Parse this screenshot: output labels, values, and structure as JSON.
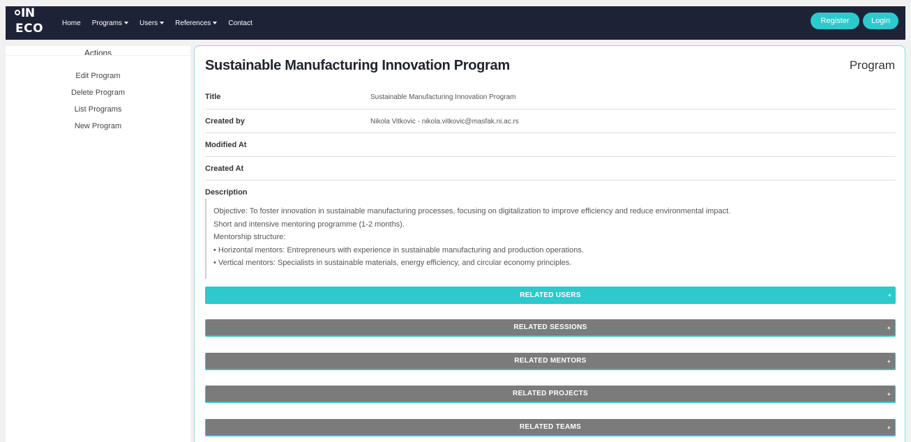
{
  "navbar": {
    "logo_line1": "IN",
    "logo_line2": "ECO",
    "items": [
      {
        "label": "Home",
        "dropdown": false
      },
      {
        "label": "Programs",
        "dropdown": true
      },
      {
        "label": "Users",
        "dropdown": true
      },
      {
        "label": "References",
        "dropdown": true
      },
      {
        "label": "Contact",
        "dropdown": false
      }
    ],
    "register_label": "Register",
    "login_label": "Login"
  },
  "sidebar": {
    "title": "Actions",
    "items": [
      {
        "label": "Edit Program"
      },
      {
        "label": "Delete Program"
      },
      {
        "label": "List Programs"
      },
      {
        "label": "New Program"
      }
    ]
  },
  "main": {
    "title": "Sustainable Manufacturing Innovation Program",
    "entity_type": "Program",
    "fields": [
      {
        "label": "Title",
        "value": "Sustainable Manufacturing Innovation Program"
      },
      {
        "label": "Created by",
        "value": "Nikola Vitkovic - nikola.vitkovic@masfak.ni.ac.rs"
      },
      {
        "label": "Modified At",
        "value": ""
      },
      {
        "label": "Created At",
        "value": ""
      }
    ],
    "description_label": "Description",
    "description_lines": [
      "Objective: To foster innovation in sustainable manufacturing processes, focusing on digitalization to improve efficiency and reduce environmental impact.",
      "Short and intensive mentoring programme (1-2 months).",
      "Mentorship structure:",
      "• Horizontal mentors: Entrepreneurs with experience in sustainable manufacturing and production operations.",
      "• Vertical mentors: Specialists in sustainable materials, energy efficiency, and circular economy principles."
    ],
    "accordions": [
      {
        "label": "RELATED USERS",
        "active": true,
        "icon": "+"
      },
      {
        "label": "RELATED SESSIONS",
        "active": false,
        "icon": "+"
      },
      {
        "label": "RELATED MENTORS",
        "active": false,
        "icon": "+"
      },
      {
        "label": "RELATED PROJECTS",
        "active": false,
        "icon": "+"
      },
      {
        "label": "RELATED TEAMS",
        "active": false,
        "icon": "+"
      }
    ]
  },
  "colors": {
    "navbar_bg": "#1d2337",
    "accent": "#2dc9cc",
    "accordion_inactive": "#7b7b7b"
  }
}
